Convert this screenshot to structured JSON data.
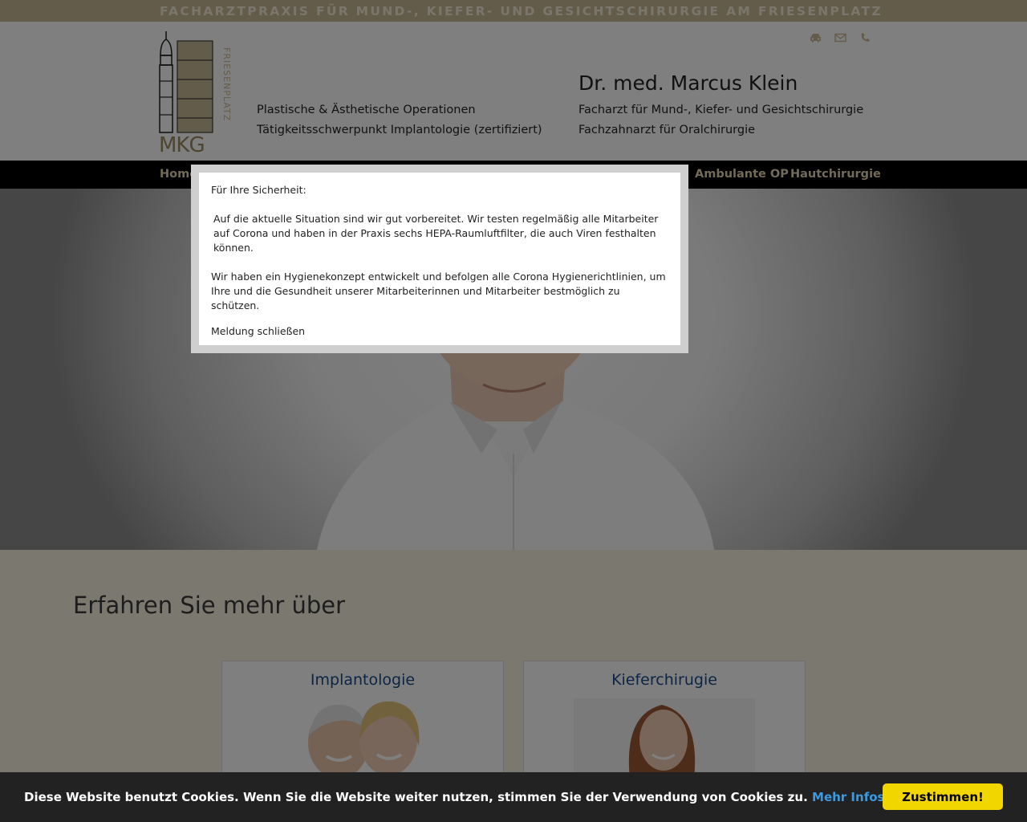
{
  "top_bar": {
    "text": "FACHARZTPRAXIS FÜR MUND-, KIEFER- UND GESICHTSCHIRURGIE AM FRIESENPLATZ"
  },
  "header": {
    "logo_text": "MKG",
    "logo_side_text": "FRIESENPLATZ",
    "tagline_1": "Plastische & Ästhetische Operationen",
    "tagline_2": "Tätigkeitsschwerpunkt Implantologie (zertifiziert)",
    "doctor_name": "Dr. med. Marcus Klein",
    "doctor_title_1": "Facharzt für Mund-, Kiefer- und Gesichtschirurgie",
    "doctor_title_2": "Fachzahnarzt für Oralchirurgie",
    "contact_icons": [
      "car-icon",
      "mail-icon",
      "phone-icon"
    ]
  },
  "nav": {
    "items": [
      "Home",
      "Ambulante OP",
      "Hautchirurgie"
    ]
  },
  "section": {
    "title": "Erfahren Sie mehr über",
    "cards": [
      {
        "title": "Implantologie"
      },
      {
        "title": "Kieferchirugie"
      }
    ]
  },
  "modal": {
    "heading": "Für Ihre Sicherheit:",
    "paragraph_1": "Auf die aktuelle Situation sind wir gut vorbereitet. Wir testen regelmäßig alle Mitarbeiter auf Corona und haben in der Praxis sechs HEPA-Raumluftfilter, die auch Viren festhalten können.",
    "paragraph_2": "Wir haben ein Hygienekonzept entwickelt und befolgen alle Corona Hygienerichtlinien, um Ihre und die Gesundheit unserer Mitarbeiterinnen und Mitarbeiter bestmöglich zu schützen.",
    "close_label": "Meldung schließen"
  },
  "cookie_bar": {
    "text": "Diese Website benutzt Cookies. Wenn Sie die Website weiter nutzen, stimmen Sie der Verwendung von Cookies zu.",
    "link_label": "Mehr Infos",
    "accept_label": "Zustimmen!"
  },
  "colors": {
    "gold": "#c9b895",
    "nav_text": "#e7d5af",
    "cookie_button": "#f1d600",
    "cookie_link": "#3c9adf",
    "card_title": "#1a4a88"
  }
}
